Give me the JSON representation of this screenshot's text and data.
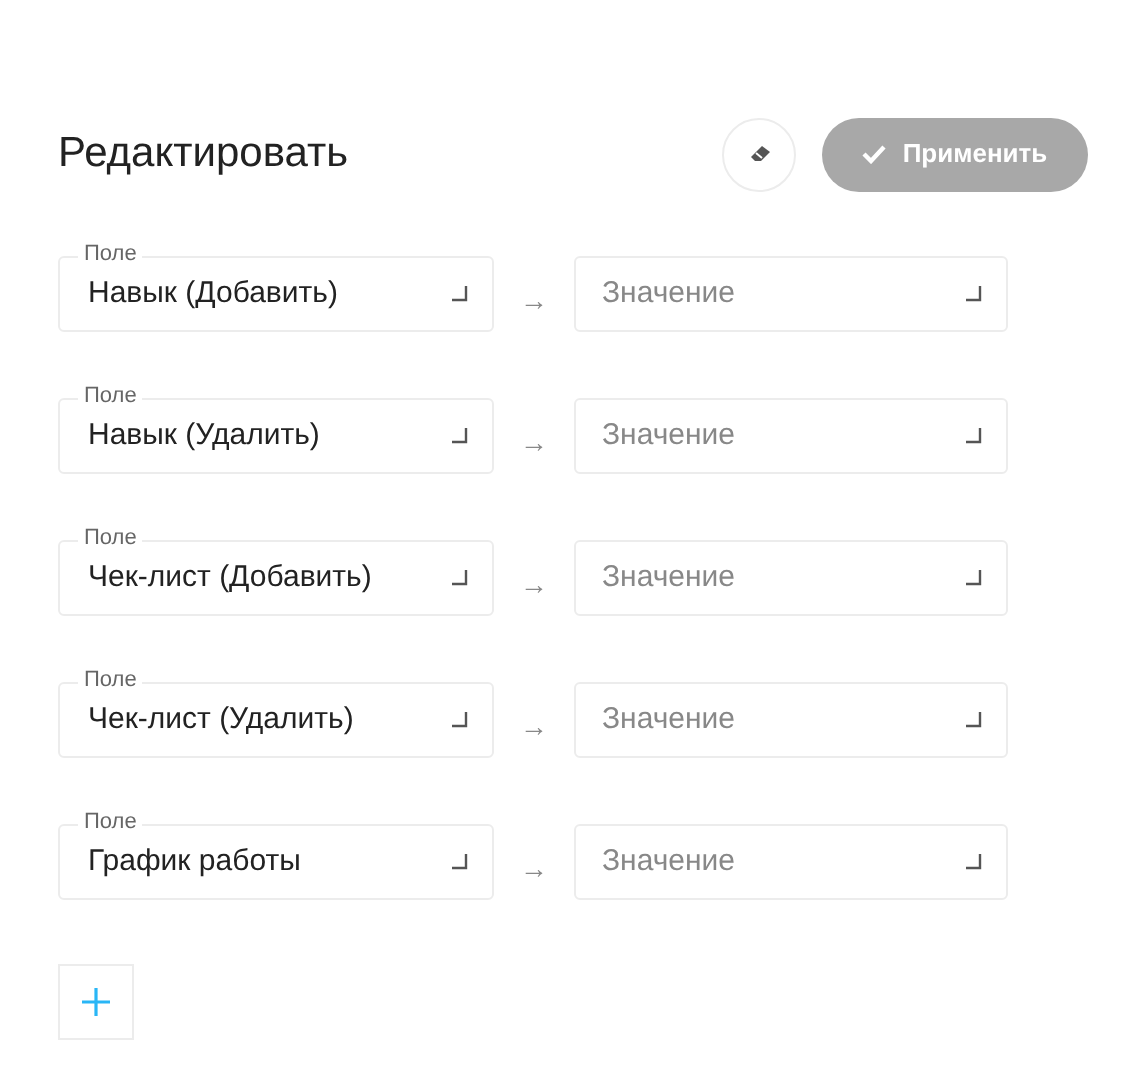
{
  "title": "Редактировать",
  "apply_button": {
    "label": "Применить",
    "disabled": true
  },
  "rows": [
    {
      "field_label": "Поле",
      "field_value": "Навык (Добавить)",
      "arrow": "→",
      "value_placeholder": "Значение"
    },
    {
      "field_label": "Поле",
      "field_value": "Навык (Удалить)",
      "arrow": "→",
      "value_placeholder": "Значение"
    },
    {
      "field_label": "Поле",
      "field_value": "Чек-лист (Добавить)",
      "arrow": "→",
      "value_placeholder": "Значение"
    },
    {
      "field_label": "Поле",
      "field_value": "Чек-лист (Удалить)",
      "arrow": "→",
      "value_placeholder": "Значение"
    },
    {
      "field_label": "Поле",
      "field_value": "График работы",
      "arrow": "→",
      "value_placeholder": "Значение"
    }
  ]
}
